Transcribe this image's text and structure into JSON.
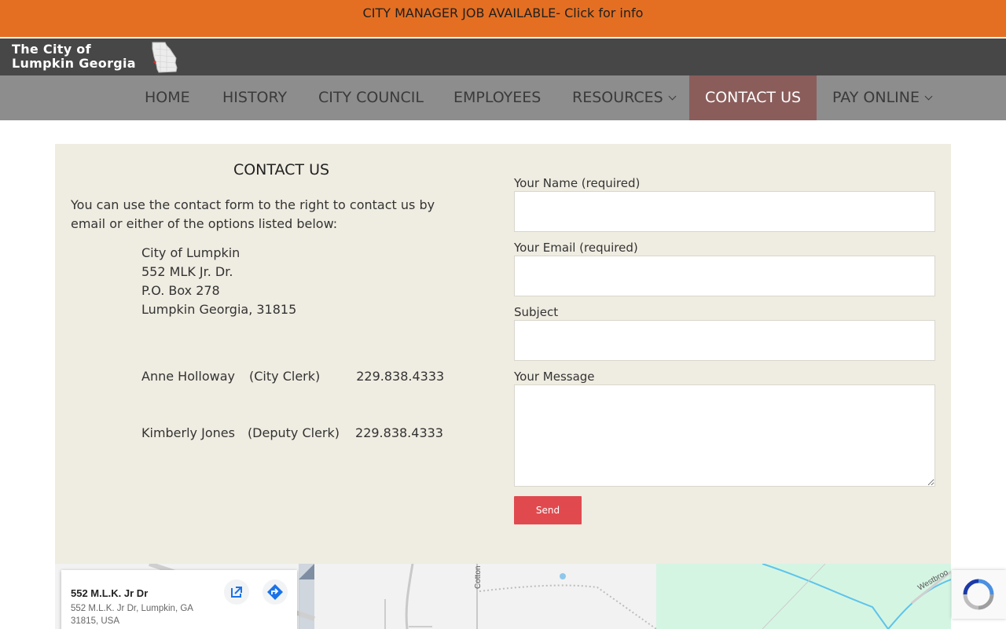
{
  "announcement": "CITY MANAGER JOB AVAILABLE- Click for info",
  "logo": {
    "line1": "The City of",
    "line2": "Lumpkin Georgia"
  },
  "nav": {
    "home": "HOME",
    "history": "HISTORY",
    "council": "CITY COUNCIL",
    "employees": "EMPLOYEES",
    "resources": "RESOURCES",
    "contact": "CONTACT US",
    "pay": "PAY ONLINE"
  },
  "contact": {
    "title": "CONTACT US",
    "intro": "You can use the contact form to the right to contact us by email or either of the options listed below:",
    "address": [
      "City of Lumpkin",
      "552 MLK Jr. Dr.",
      "P.O. Box 278",
      "Lumpkin Georgia, 31815"
    ],
    "staff": [
      {
        "name": "Anne Holloway",
        "role": "(City Clerk)",
        "phone": "229.838.4333"
      },
      {
        "name": "Kimberly Jones",
        "role": "(Deputy Clerk)",
        "phone": "229.838.4333"
      }
    ]
  },
  "form": {
    "name_label": "Your Name (required)",
    "email_label": "Your Email (required)",
    "subject_label": "Subject",
    "message_label": "Your Message",
    "send_label": "Send"
  },
  "map": {
    "place_title": "552 M.L.K. Jr Dr",
    "place_address": "552 M.L.K. Jr Dr, Lumpkin, GA 31815, USA",
    "street_cotton": "Cotton",
    "street_westbrook": "Westbroo"
  },
  "colors": {
    "announcement_bg": "#e46f22",
    "header_bg": "#474747",
    "nav_bg": "#8d8d8d",
    "nav_active_bg": "#8a5d5b",
    "panel_bg": "#efece1",
    "send_bg": "#e04a4f"
  }
}
